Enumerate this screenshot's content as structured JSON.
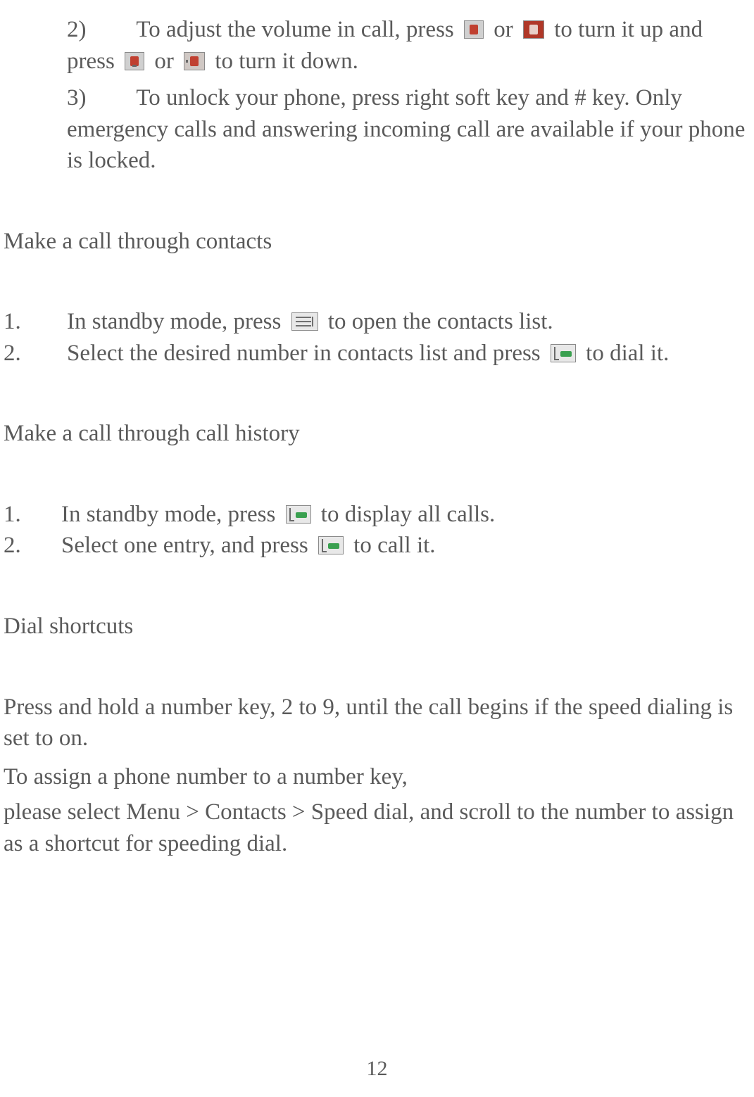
{
  "item2": {
    "num": "2)",
    "t1": "To adjust the volume in call, press ",
    "t2": " or ",
    "t3": " to turn it up and press ",
    "t4": " or ",
    "t5": " to turn it down."
  },
  "item3": {
    "num": "3)",
    "body": "To unlock your phone, press right soft key and # key. Only emergency calls and answering incoming call are available if your phone is locked."
  },
  "headings": {
    "contacts": "Make a call through contacts",
    "history": "Make a call through call history",
    "shortcuts": "Dial shortcuts"
  },
  "contacts": {
    "n1": "1.",
    "l1a": "In standby mode, press ",
    "l1b": " to open the contacts list.",
    "n2": "2.",
    "l2a": "Select the desired number in contacts list and press ",
    "l2b": " to dial it."
  },
  "history": {
    "n1": "1.",
    "l1a": "In standby mode, press ",
    "l1b": " to display all calls.",
    "n2": "2.",
    "l2a": "Select one entry, and press ",
    "l2b": " to call it."
  },
  "shortcuts": {
    "p1": "Press and hold a number key, 2 to 9, until the call begins if the speed dialing is set to on.",
    "p2": "To assign a phone number to a number key,",
    "p3": "please select Menu > Contacts > Speed dial, and scroll to the number to assign as a shortcut for speeding dial."
  },
  "pageNumber": "12"
}
